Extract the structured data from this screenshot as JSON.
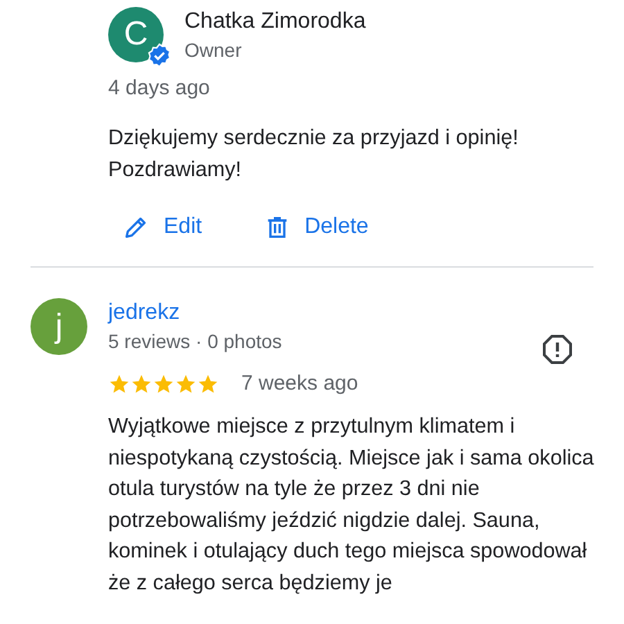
{
  "owner_reply": {
    "avatar_letter": "C",
    "verified": true,
    "name": "Chatka Zimorodka",
    "role": "Owner",
    "time": "4 days ago",
    "text": "Dziękujemy serdecznie za przyjazd i opinię! Pozdrawiamy!",
    "actions": [
      {
        "kind": "edit",
        "label": "Edit"
      },
      {
        "kind": "delete",
        "label": "Delete"
      }
    ]
  },
  "review": {
    "avatar_letter": "j",
    "name": "jedrekz",
    "meta": "5 reviews · 0 photos",
    "stars": 5,
    "time": "7 weeks ago",
    "text": "Wyjątkowe miejsce z przytulnym klimatem i niespotykaną czystością. Miejsce jak i sama okolica otula turystów na tyle że przez 3 dni nie potrzebowaliśmy jeździć nigdzie dalej. Sauna, kominek i otulający duch tego miejsca spowodował że z całego serca będziemy je"
  }
}
